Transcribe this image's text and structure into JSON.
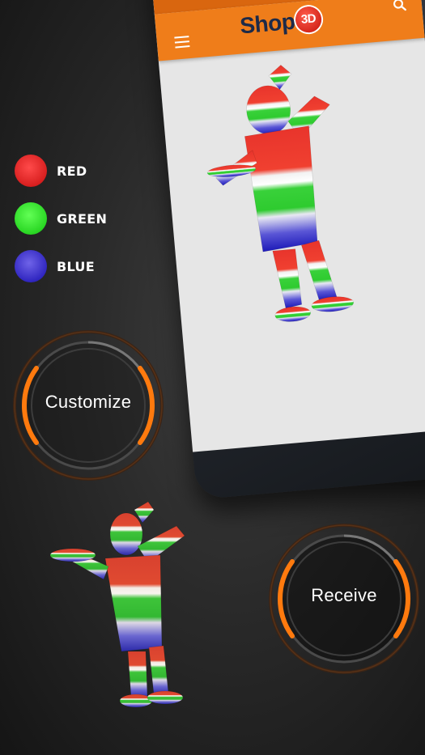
{
  "app": {
    "logo_text": "Shop",
    "logo_badge": "3D"
  },
  "status_bar": {
    "signal_icon": "signal-icon",
    "battery_icon": "battery-icon"
  },
  "legend": [
    {
      "label": "RED",
      "color": "#e8262b"
    },
    {
      "label": "GREEN",
      "color": "#2fd629"
    },
    {
      "label": "BLUE",
      "color": "#2b24b5"
    }
  ],
  "buttons": {
    "customize": "Customize",
    "receive": "Receive"
  },
  "colors": {
    "accent": "#ef7d1a",
    "accent_ring": "#ff7a0e"
  }
}
